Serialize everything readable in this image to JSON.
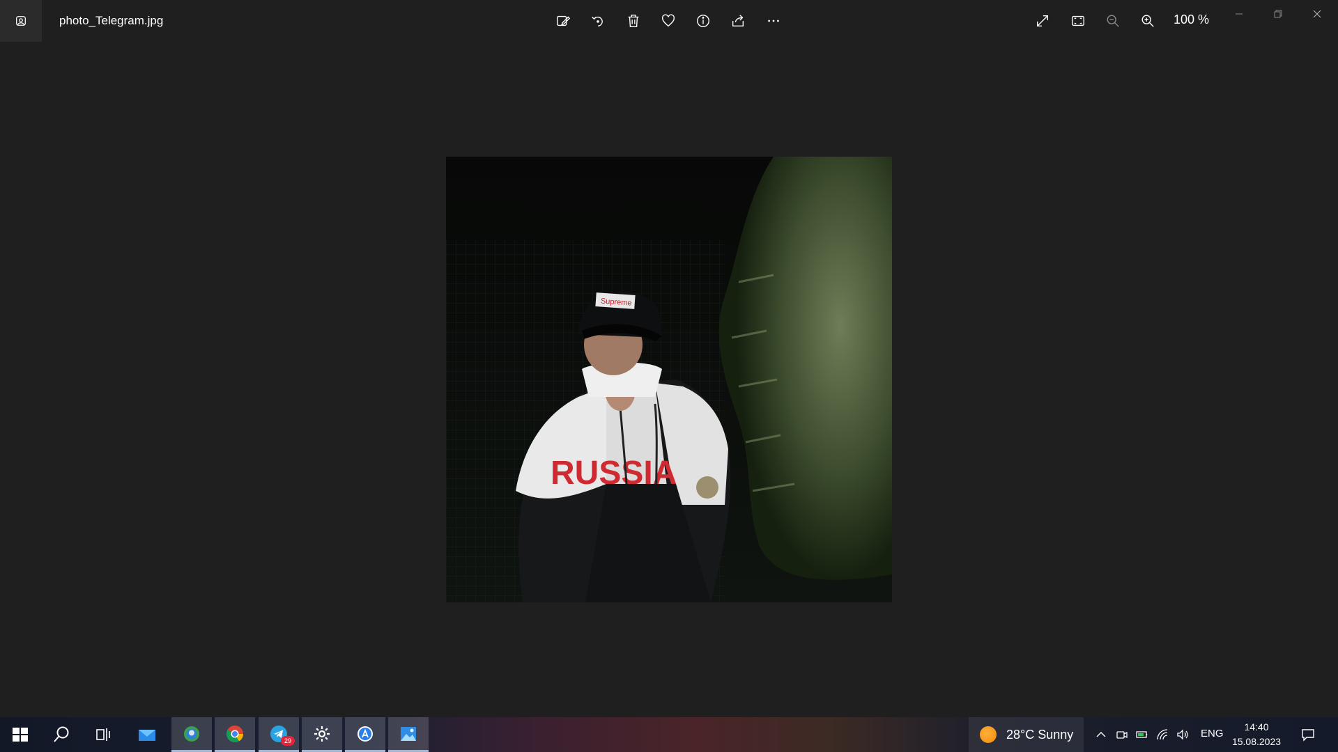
{
  "window": {
    "title": "photo_Telegram.jpg",
    "zoom": "100 %"
  },
  "toolbar": {
    "items": [
      "edit-icon",
      "rotate-icon",
      "delete-icon",
      "favorite-icon",
      "info-icon",
      "share-icon",
      "more-icon"
    ],
    "right_items": [
      "fullscreen-icon",
      "fit-icon",
      "zoom-out-icon",
      "zoom-in-icon"
    ]
  },
  "photo": {
    "cap_text": "Supreme",
    "jacket_text": "RUSSIA"
  },
  "taskbar": {
    "apps": [
      "start",
      "search",
      "task-view",
      "mail",
      "edge",
      "chrome",
      "telegram",
      "settings",
      "app-store",
      "photos"
    ],
    "telegram_badge": "29",
    "weather": "28°C  Sunny",
    "language": "ENG",
    "time": "14:40",
    "date": "15.08.2023"
  },
  "colors": {
    "background": "#1f1f1f",
    "accent": "#9fb6d6"
  }
}
